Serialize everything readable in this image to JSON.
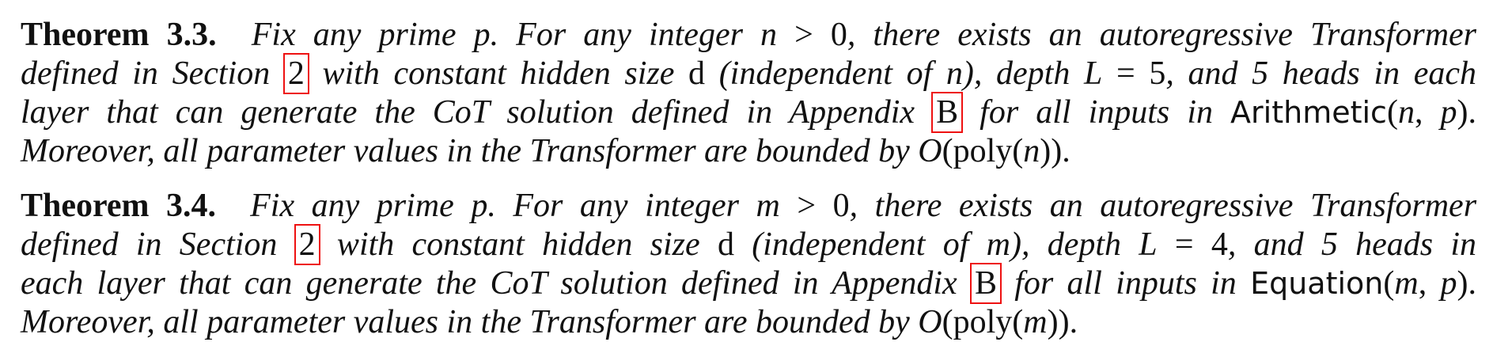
{
  "theorems": [
    {
      "label": "Theorem 3.3.",
      "line1": {
        "a": "Fix any prime ",
        "p": "p",
        "b": ". For any integer ",
        "n": "n",
        "gt": " > ",
        "zero": "0",
        "c": ", there exists an autoregressive Transformer"
      },
      "line2": {
        "a": "defined in Section ",
        "ref": "2",
        "b": " with constant hidden size ",
        "d": "d",
        "c": " (independent of ",
        "n": "n",
        "e": "), depth ",
        "L": "L",
        "eq": " = ",
        "depth": "5",
        "f": ", and 5 heads in each"
      },
      "line3": {
        "a": "layer that can generate the CoT solution defined in Appendix ",
        "ref": "B",
        "b": " for all inputs in ",
        "task": "Arithmetic",
        "open": "(",
        "arg1": "n",
        "comma": ", ",
        "arg2": "p",
        "close": ").",
        "tail": ""
      },
      "line4": {
        "a": "Moreover, all parameter values in the Transformer are bounded by ",
        "O": "O",
        "open": "(poly(",
        "var": "n",
        "close": "))."
      }
    },
    {
      "label": "Theorem 3.4.",
      "line1": {
        "a": "Fix any prime ",
        "p": "p",
        "b": ". For any integer ",
        "n": "m",
        "gt": " > ",
        "zero": "0",
        "c": ", there exists an autoregressive Transformer"
      },
      "line2": {
        "a": "defined in Section ",
        "ref": "2",
        "b": " with constant hidden size ",
        "d": "d",
        "c": " (independent of ",
        "n": "m",
        "e": "), depth ",
        "L": "L",
        "eq": " = ",
        "depth": "4",
        "f": ", and 5 heads in"
      },
      "line3": {
        "a": "each layer that can generate the CoT solution defined in Appendix ",
        "ref": "B",
        "b": " for all inputs in ",
        "task": "Equation",
        "open": "(",
        "arg1": "m",
        "comma": ", ",
        "arg2": "p",
        "close": ").",
        "tail": ""
      },
      "line4": {
        "a": "Moreover, all parameter values in the Transformer are bounded by ",
        "O": "O",
        "open": "(poly(",
        "var": "m",
        "close": "))."
      }
    }
  ]
}
